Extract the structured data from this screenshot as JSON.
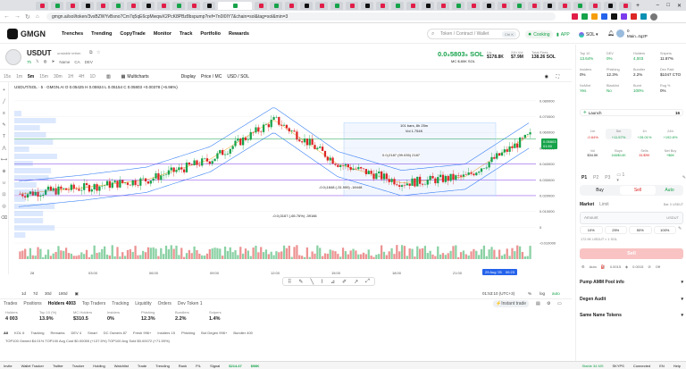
{
  "browser": {
    "url": "gmgn.ai/sol/token/3vsBZWYvBsno7Cm7q5qE6cpMwqwX2PcK8PBz8bspump?ref=7n0I0IY7&chain=sol&tag=sol&min=3"
  },
  "header": {
    "logo": "GMGN",
    "nav": [
      "Trenches",
      "Trending",
      "CopyTrade",
      "Monitor",
      "Track",
      "Portfolio",
      "Rewards"
    ],
    "search_placeholder": "Token / Contract / Wallet",
    "search_shortcut": "Ctrl K",
    "cooking": "Cooking",
    "app": "APP",
    "chain": "SOL",
    "account_top": "0",
    "account_name": "Main..4q2P"
  },
  "coin": {
    "symbol": "USDUT",
    "subtitle": "unstable tether",
    "age": "7h",
    "tags": [
      "Name",
      "CA",
      "DEV"
    ],
    "price": "0.0₅5803₅ SOL",
    "mc": "MC $.80K SOL",
    "liq_label": "Liq",
    "liq": "$178.8K",
    "vol_label": "24h Vol",
    "vol": "$7.9M",
    "fees_label": "Total Fees",
    "fees": "138.26 SOL"
  },
  "toolbar": {
    "timeframes": [
      "15s",
      "1m",
      "5m",
      "15m",
      "30m",
      "1H",
      "4H",
      "1D"
    ],
    "active_tf": "5m",
    "multicharts": "Multicharts",
    "display": "Display",
    "price_mc": "Price / MC",
    "usd_sol": "USD / SOL"
  },
  "chart": {
    "ohlc": "USDUT/SOL · 5 · GMGN.AI  O 0.05425  H 0.05924  L 0.05154  C 0.05803  +0.00378 (+6.96%)",
    "price_tag": "0.05803",
    "price_tag_time": "01:50",
    "annotation1": "101 bars, 8h 25m",
    "annotation2": "Vol 1.754K",
    "annotation3": "0.0₂2187 (99.035) 2187",
    "annotation4": "-0.0₃1848 (-31.555) -18448",
    "annotation5": "-0.0₃3167 (-65.76%) -39166",
    "date_label": "29 Aug '25",
    "date_time": "00:23",
    "clock": "01:53:10 (UTC+3)",
    "bottom_right": [
      "%",
      "log",
      "auto"
    ],
    "ranges": [
      "1d",
      "7d",
      "30d",
      "180d"
    ]
  },
  "chart_data": {
    "type": "line",
    "title": "USDUT/SOL · 5 · GMGN.AI",
    "xlabel": "",
    "ylabel": "",
    "x": [
      "28",
      "03:00",
      "06:00",
      "09:00",
      "12:00",
      "15:00",
      "18:00",
      "21:00",
      "00:23"
    ],
    "series": [
      {
        "name": "USDUT/SOL",
        "values": [
          0.021,
          0.025,
          0.03,
          0.043,
          0.068,
          0.04,
          0.028,
          0.032,
          0.058
        ]
      }
    ],
    "y_ticks": [
      "0.080000",
      "0.070000",
      "0.060000",
      "0.050000",
      "0.040000",
      "0.030000",
      "0.020000",
      "0.010000",
      "0",
      "-0.010000"
    ],
    "ylim": [
      -0.01,
      0.085
    ]
  },
  "bottom": {
    "tabs": [
      "Trades",
      "Positions",
      "Holders 4003",
      "Top Traders",
      "Tracking",
      "Liquidity",
      "Orders",
      "Dev Token 1"
    ],
    "instant": "Instant trade",
    "stats": [
      {
        "label": "Holders",
        "value": "4 003"
      },
      {
        "label": "Top 10 (%)",
        "value": "13.9%"
      },
      {
        "label": "MC Holders",
        "value": "$310.5"
      },
      {
        "label": "Insiders",
        "value": "0%"
      },
      {
        "label": "Phishing",
        "value": "12.3%"
      },
      {
        "label": "Bundlers",
        "value": "2.2%"
      },
      {
        "label": "Snipers",
        "value": "1.4%"
      }
    ],
    "filters": [
      "All",
      "KOL 6",
      "Tracking",
      "Remarks",
      "DEV 4",
      "Smart",
      "DC Owners 87",
      "Fresh 996+",
      "Insiders 15",
      "Phishing",
      "Bot Degen 996+",
      "Bundler 400"
    ],
    "top_line": "TOP100 Owned $4.01%  TOP100 Avg Cost $0.00055 (+137.5%)  TOP100 Avg Sold $0.00072 (+71.59%)"
  },
  "right": {
    "top": [
      {
        "label": "Top 10",
        "value": "13.64%"
      },
      {
        "label": "DEV",
        "value": "0%"
      },
      {
        "label": "Holders",
        "value": "4,003"
      },
      {
        "label": "Snipers",
        "value": "11.87%"
      }
    ],
    "second": [
      {
        "label": "Insiders",
        "value": "0%"
      },
      {
        "label": "Phishing",
        "value": "12.3%"
      },
      {
        "label": "Bundler",
        "value": "2.2%"
      },
      {
        "label": "Dex Paid",
        "value": "$1047 CTO"
      }
    ],
    "third": [
      {
        "label": "NoMint",
        "value": "Yes"
      },
      {
        "label": "Blacklist",
        "value": "No"
      },
      {
        "label": "Burnt",
        "value": "100%"
      },
      {
        "label": "Rug %",
        "value": "0%"
      }
    ],
    "launch": "Launch",
    "launch_count": "16",
    "periods": [
      {
        "label": "1m",
        "value": "-0.64%"
      },
      {
        "label": "5m",
        "value": "+11.57%"
      },
      {
        "label": "1h",
        "value": "+28.01%"
      },
      {
        "label": "24h",
        "value": "+192.8%"
      }
    ],
    "vol_row": [
      {
        "label": "Vol",
        "value": "$34.5K"
      },
      {
        "label": "Buys",
        "value": "168/$14K"
      },
      {
        "label": "Sells",
        "value": "81/$9K"
      },
      {
        "label": "Net Buy",
        "value": "+$6K"
      }
    ],
    "presets": [
      "P1",
      "P2",
      "P3"
    ],
    "buy": "Buy",
    "sell": "Sell",
    "auto": "Auto",
    "market": "Market",
    "limit": "Limit",
    "bal": "Bal: 0 USDUT",
    "amount_label": "Amount",
    "amount_unit": "USDUT",
    "pcts": [
      "10%",
      "25%",
      "50%",
      "100%"
    ],
    "est": "172.9K USDUT ≈ 1 SOL",
    "sell_btn": "Sell",
    "auto_row": [
      "Auto",
      "0.0015",
      "0.0015",
      "Off"
    ],
    "sections": [
      "Pump AMM Pool info",
      "Degen Audit",
      "Same Name Tokens"
    ]
  },
  "status": {
    "items": [
      "Invite",
      "Wallet Tracker",
      "Twitter",
      "Tracker",
      "Holding",
      "Watchlist",
      "Trade",
      "Trending",
      "Rank",
      "P/L",
      "Signal",
      "$214.47",
      "$98K"
    ],
    "right": [
      "Stable 34 MS",
      "SKYPS",
      "Connected",
      "EN",
      "Help"
    ]
  }
}
